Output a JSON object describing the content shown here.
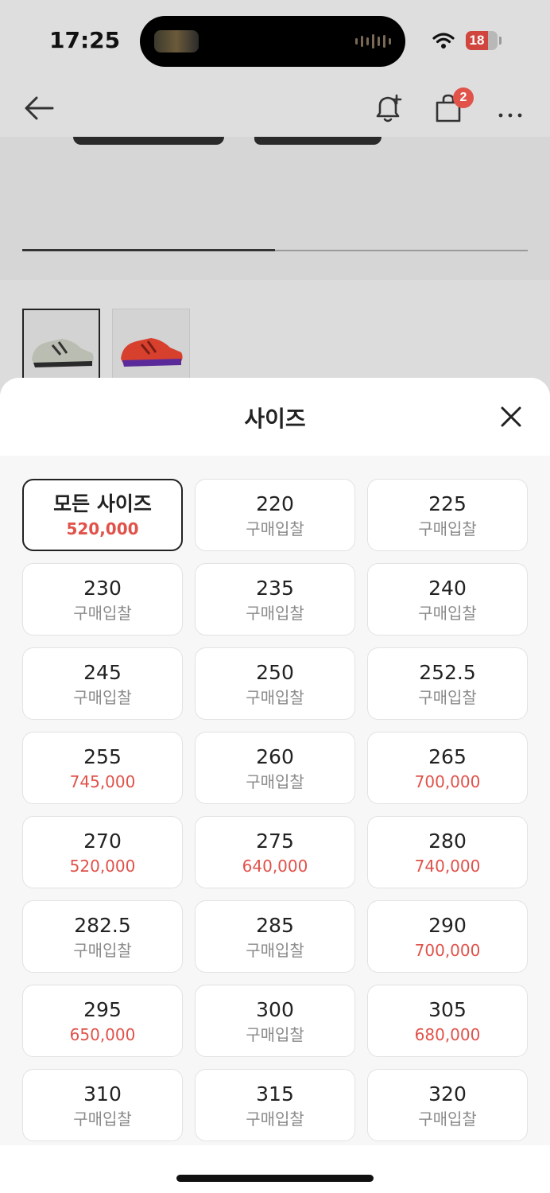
{
  "status_bar": {
    "time": "17:25",
    "battery": "18",
    "battery_level": 0.18
  },
  "top_nav": {
    "cart_badge": "2"
  },
  "product": {
    "image_progress": 0.5
  },
  "sheet": {
    "title": "사이즈",
    "sizes": [
      {
        "label": "모든 사이즈",
        "sub": "520,000",
        "type": "price",
        "selected": true
      },
      {
        "label": "220",
        "sub": "구매입찰",
        "type": "bid"
      },
      {
        "label": "225",
        "sub": "구매입찰",
        "type": "bid"
      },
      {
        "label": "230",
        "sub": "구매입찰",
        "type": "bid"
      },
      {
        "label": "235",
        "sub": "구매입찰",
        "type": "bid"
      },
      {
        "label": "240",
        "sub": "구매입찰",
        "type": "bid"
      },
      {
        "label": "245",
        "sub": "구매입찰",
        "type": "bid"
      },
      {
        "label": "250",
        "sub": "구매입찰",
        "type": "bid"
      },
      {
        "label": "252.5",
        "sub": "구매입찰",
        "type": "bid"
      },
      {
        "label": "255",
        "sub": "745,000",
        "type": "price"
      },
      {
        "label": "260",
        "sub": "구매입찰",
        "type": "bid"
      },
      {
        "label": "265",
        "sub": "700,000",
        "type": "price"
      },
      {
        "label": "270",
        "sub": "520,000",
        "type": "price"
      },
      {
        "label": "275",
        "sub": "640,000",
        "type": "price"
      },
      {
        "label": "280",
        "sub": "740,000",
        "type": "price"
      },
      {
        "label": "282.5",
        "sub": "구매입찰",
        "type": "bid"
      },
      {
        "label": "285",
        "sub": "구매입찰",
        "type": "bid"
      },
      {
        "label": "290",
        "sub": "700,000",
        "type": "price"
      },
      {
        "label": "295",
        "sub": "650,000",
        "type": "price"
      },
      {
        "label": "300",
        "sub": "구매입찰",
        "type": "bid"
      },
      {
        "label": "305",
        "sub": "680,000",
        "type": "price"
      },
      {
        "label": "310",
        "sub": "구매입찰",
        "type": "bid"
      },
      {
        "label": "315",
        "sub": "구매입찰",
        "type": "bid"
      },
      {
        "label": "320",
        "sub": "구매입찰",
        "type": "bid"
      }
    ]
  },
  "colors": {
    "price_red": "#e0524a",
    "bid_gray": "#8a8a8a",
    "badge_red": "#e0524a"
  },
  "icons": {
    "back": "arrow-left-icon",
    "bell": "bell-plus-icon",
    "cart": "shopping-bag-icon",
    "more": "more-horizontal-icon",
    "close": "close-icon",
    "wifi": "wifi-icon"
  }
}
